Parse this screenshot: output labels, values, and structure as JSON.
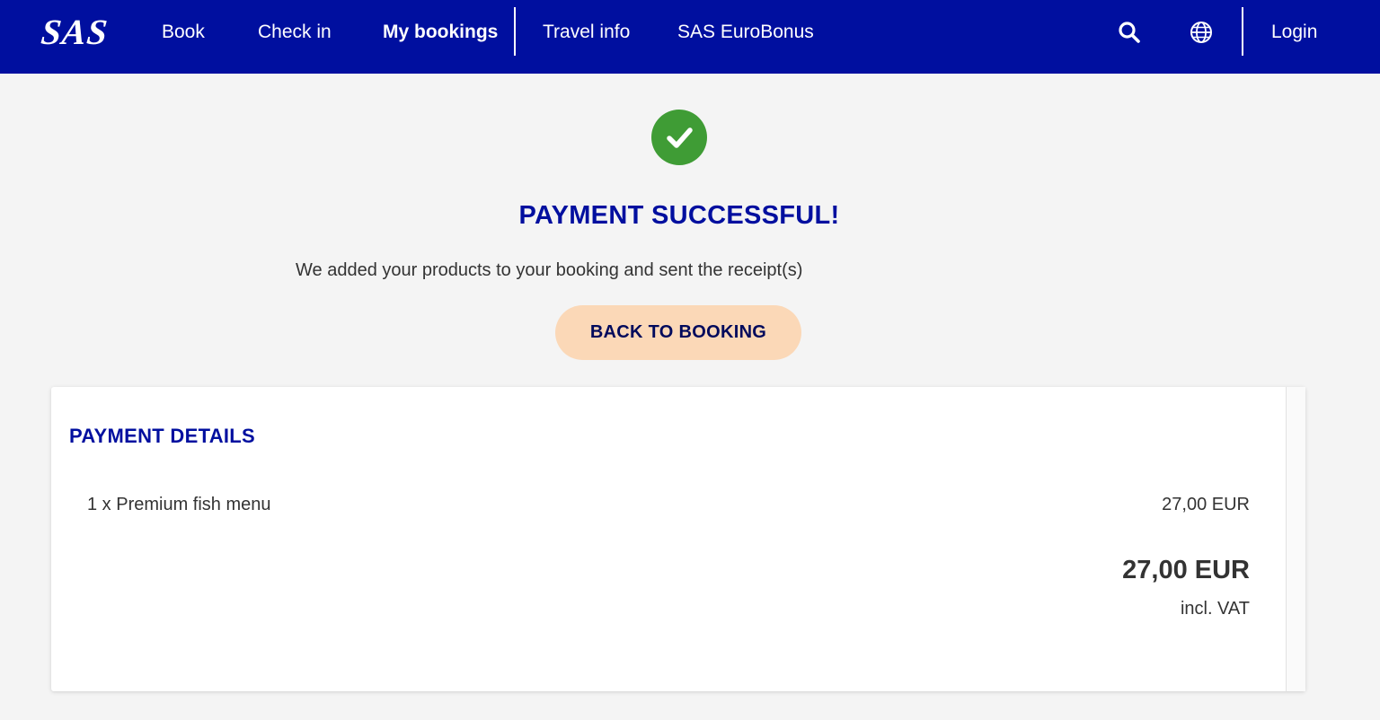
{
  "header": {
    "logo": "SAS",
    "nav": {
      "book": "Book",
      "check_in": "Check in",
      "my_bookings": "My bookings",
      "travel_info": "Travel info",
      "eurobonus": "SAS EuroBonus"
    },
    "search_icon": "search-icon",
    "language_icon": "globe-icon",
    "login": "Login"
  },
  "success": {
    "icon": "checkmark-icon",
    "title": "PAYMENT SUCCESSFUL!",
    "message": "We added your products to your booking and sent the receipt(s)",
    "back_button": "BACK TO BOOKING"
  },
  "payment_details": {
    "title": "PAYMENT DETAILS",
    "items": [
      {
        "description": "1 x Premium fish menu",
        "price": "27,00 EUR"
      }
    ],
    "total": "27,00 EUR",
    "vat_note": "incl. VAT"
  },
  "colors": {
    "brand_blue": "#000f9f",
    "success_green": "#3f9c35",
    "button_peach": "#fbd8b7",
    "background": "#f4f4f4"
  }
}
